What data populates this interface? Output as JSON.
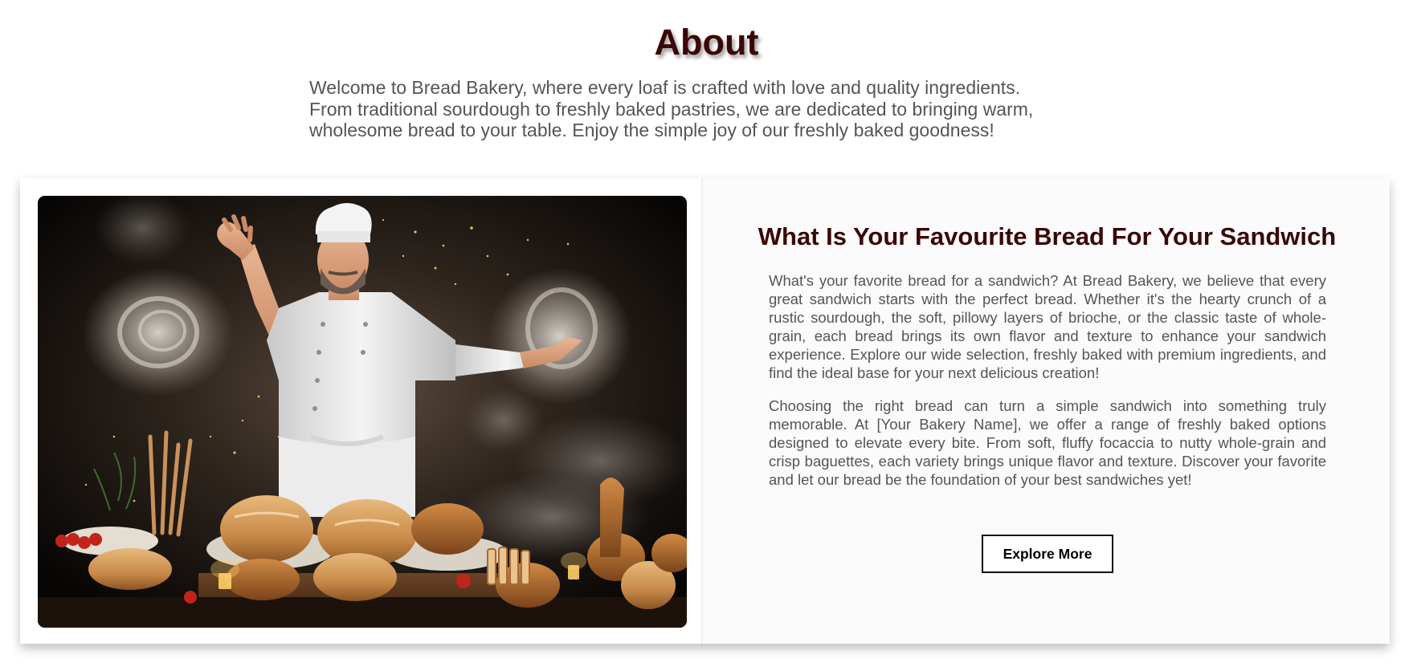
{
  "about": {
    "title": "About",
    "intro": "Welcome to Bread Bakery, where every loaf is crafted with love and quality ingredients. From traditional sourdough to freshly baked pastries, we are dedicated to bringing warm, wholesome bread to your table. Enjoy the simple joy of our freshly baked goodness!"
  },
  "feature": {
    "title": "What Is Your Favourite Bread For Your Sandwich",
    "paragraph_1": "What's your favorite bread for a sandwich? At Bread Bakery, we believe that every great sandwich starts with the perfect bread. Whether it's the hearty crunch of a rustic sourdough, the soft, pillowy layers of brioche, or the classic taste of whole-grain, each bread brings its own flavor and texture to enhance your sandwich experience. Explore our wide selection, freshly baked with premium ingredients, and find the ideal base for your next delicious creation!",
    "paragraph_2": "Choosing the right bread can turn a simple sandwich into something truly memorable. At [Your Bakery Name], we offer a range of freshly baked options designed to elevate every bite. From soft, fluffy focaccia to nutty whole-grain and crisp baguettes, each variety brings unique flavor and texture. Discover your favorite and let our bread be the foundation of your best sandwiches yet!",
    "button_label": "Explore More"
  },
  "image": {
    "subject": "chef-with-bread-illustration"
  },
  "colors": {
    "heading": "#3a0707",
    "body_text": "#555555",
    "card_background": "#fbfbfb",
    "button_border": "#111111"
  }
}
